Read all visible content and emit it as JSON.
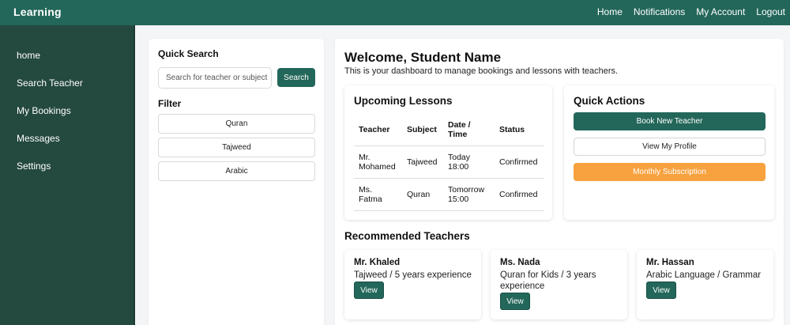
{
  "topbar": {
    "brand": "Learning",
    "nav": [
      "Home",
      "Notifications",
      "My Account",
      "Logout"
    ]
  },
  "sidebar": {
    "items": [
      "home",
      "Search Teacher",
      "My Bookings",
      "Messages",
      "Settings"
    ]
  },
  "quick_search": {
    "title": "Quick Search",
    "placeholder": "Search for teacher or subject",
    "button": "Search",
    "filter_title": "Filter",
    "filters": [
      "Quran",
      "Tajweed",
      "Arabic"
    ]
  },
  "main": {
    "welcome": "Welcome, Student Name",
    "subtitle": "This is your dashboard to manage bookings and lessons with teachers."
  },
  "lessons": {
    "title": "Upcoming Lessons",
    "headers": [
      "Teacher",
      "Subject",
      "Date / Time",
      "Status"
    ],
    "rows": [
      [
        "Mr. Mohamed",
        "Tajweed",
        "Today 18:00",
        "Confirmed"
      ],
      [
        "Ms. Fatma",
        "Quran",
        "Tomorrow 15:00",
        "Confirmed"
      ]
    ]
  },
  "quick_actions": {
    "title": "Quick Actions",
    "buttons": [
      "Book New Teacher",
      "View My Profile",
      "Monthly Subscription"
    ]
  },
  "recommended": {
    "title": "Recommended Teachers",
    "teachers": [
      {
        "name": "Mr. Khaled",
        "desc": "Tajweed / 5 years experience",
        "button": "View"
      },
      {
        "name": "Ms. Nada",
        "desc": "Quran for Kids / 3 years experience",
        "button": "View"
      },
      {
        "name": "Mr. Hassan",
        "desc": "Arabic Language / Grammar",
        "button": "View"
      }
    ]
  },
  "colors": {
    "primary": "#23675a",
    "sidebar": "#24493f",
    "accent": "#f7a23e",
    "background": "#f4f5f7"
  }
}
